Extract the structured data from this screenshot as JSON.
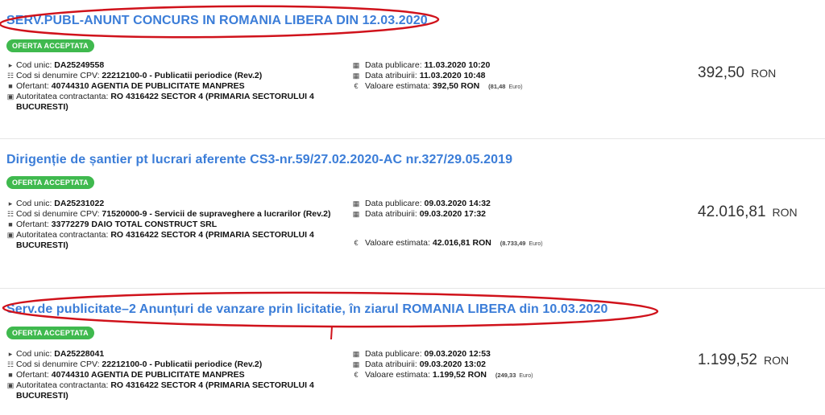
{
  "items": [
    {
      "title": "SERV.PUBL-ANUNT CONCURS IN ROMANIA LIBERA DIN 12.03.2020",
      "badge": "OFERTA ACCEPTATA",
      "cod_unic_label": "Cod unic:",
      "cod_unic": "DA25249558",
      "cpv_label": "Cod si denumire CPV:",
      "cpv": "22212100-0 - Publicatii periodice (Rev.2)",
      "ofertant_label": "Ofertant:",
      "ofertant": "40744310 AGENTIA DE PUBLICITATE MANPRES",
      "autoritate_label": "Autoritatea contractanta:",
      "autoritate": "RO 4316422 SECTOR 4 (PRIMARIA SECTORULUI 4 BUCURESTI)",
      "data_publicare_label": "Data publicare:",
      "data_publicare": "11.03.2020 10:20",
      "data_atribuirii_label": "Data atribuirii:",
      "data_atribuirii": "11.03.2020 10:48",
      "valoare_label": "Valoare estimata:",
      "valoare": "392,50",
      "valoare_cur": "RON",
      "valoare_euro": "(81,48",
      "valoare_euro_cur": "Euro)",
      "price": "392,50",
      "price_cur": "RON"
    },
    {
      "title": "Dirigenție de șantier pt lucrari aferente CS3-nr.59/27.02.2020-AC nr.327/29.05.2019",
      "badge": "OFERTA ACCEPTATA",
      "cod_unic_label": "Cod unic:",
      "cod_unic": "DA25231022",
      "cpv_label": "Cod si denumire CPV:",
      "cpv": "71520000-9 - Servicii de supraveghere a lucrarilor (Rev.2)",
      "ofertant_label": "Ofertant:",
      "ofertant": "33772279 DAIO TOTAL CONSTRUCT SRL",
      "autoritate_label": "Autoritatea contractanta:",
      "autoritate": "RO 4316422 SECTOR 4 (PRIMARIA SECTORULUI 4 BUCURESTI)",
      "data_publicare_label": "Data publicare:",
      "data_publicare": "09.03.2020 14:32",
      "data_atribuirii_label": "Data atribuirii:",
      "data_atribuirii": "09.03.2020 17:32",
      "valoare_label": "Valoare estimata:",
      "valoare": "42.016,81",
      "valoare_cur": "RON",
      "valoare_euro": "(8.733,49",
      "valoare_euro_cur": "Euro)",
      "price": "42.016,81",
      "price_cur": "RON"
    },
    {
      "title": "Serv.de publicitate–2 Anunțuri de vanzare prin licitatie, în ziarul ROMANIA LIBERA din 10.03.2020",
      "badge": "OFERTA ACCEPTATA",
      "cod_unic_label": "Cod unic:",
      "cod_unic": "DA25228041",
      "cpv_label": "Cod si denumire CPV:",
      "cpv": "22212100-0 - Publicatii periodice (Rev.2)",
      "ofertant_label": "Ofertant:",
      "ofertant": "40744310 AGENTIA DE PUBLICITATE MANPRES",
      "autoritate_label": "Autoritatea contractanta:",
      "autoritate": "RO 4316422 SECTOR 4 (PRIMARIA SECTORULUI 4 BUCURESTI)",
      "data_publicare_label": "Data publicare:",
      "data_publicare": "09.03.2020 12:53",
      "data_atribuirii_label": "Data atribuirii:",
      "data_atribuirii": "09.03.2020 13:02",
      "valoare_label": "Valoare estimata:",
      "valoare": "1.199,52",
      "valoare_cur": "RON",
      "valoare_euro": "(249,33",
      "valoare_euro_cur": "Euro)",
      "price": "1.199,52",
      "price_cur": "RON"
    }
  ],
  "icons": {
    "cod_unic": "tag-icon",
    "cpv": "sitemap-icon",
    "ofertant": "user-icon",
    "autoritate": "briefcase-icon",
    "data_publicare": "calendar-icon",
    "data_atribuirii": "calendar-icon",
    "valoare": "euro-icon"
  },
  "colors": {
    "title": "#3b7dd8",
    "badge": "#3fb94e",
    "annotation": "#d0121b"
  }
}
